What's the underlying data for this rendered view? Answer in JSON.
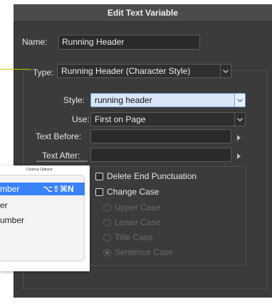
{
  "dialog": {
    "title": "Edit Text Variable",
    "name_label": "Name:",
    "name_value": "Running Header",
    "type_label": "Type:",
    "type_value": "Running Header (Character Style)",
    "style_label": "Style:",
    "style_value": "running header",
    "use_label": "Use:",
    "use_value": "First on Page",
    "text_before_label": "Text Before:",
    "text_before_value": "",
    "text_after_label": "Text After:",
    "text_after_value": "",
    "options": {
      "delete_end_punctuation": "Delete End Punctuation",
      "change_case": "Change Case",
      "upper_case": "Upper Case",
      "lower_case": "Lower Case",
      "title_case": "Title Case",
      "sentence_case": "Sentence Case"
    }
  },
  "overlay": {
    "contour_options_label": "Contour Options:",
    "menu_items": [
      {
        "label": "mber",
        "shortcut": "⌥⇧⌘N"
      },
      {
        "label": "er",
        "shortcut": ""
      },
      {
        "label": "umber",
        "shortcut": ""
      }
    ]
  },
  "colors": {
    "dialog_bg": "#3b3b3b",
    "titlebar_bg": "#4b4b4b",
    "highlight": "#3a82f7",
    "callout_line": "#c8c800"
  }
}
